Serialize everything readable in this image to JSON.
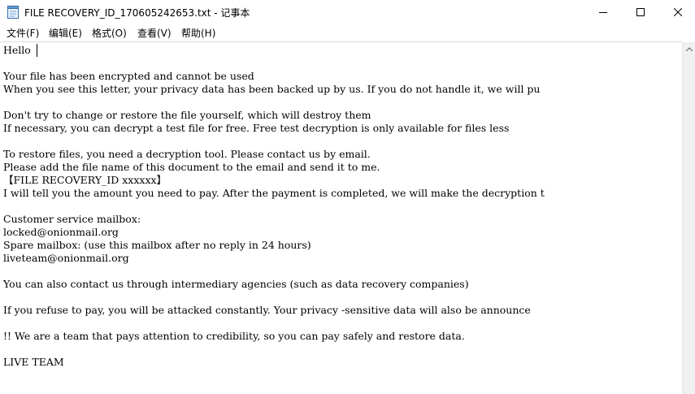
{
  "window": {
    "title": "FILE RECOVERY_ID_170605242653.txt - 记事本",
    "app_icon": "notepad-icon",
    "controls": {
      "minimize_icon": "minimize-icon",
      "maximize_icon": "maximize-icon",
      "close_icon": "close-icon"
    }
  },
  "menu": {
    "items": [
      {
        "label": "文件(F)"
      },
      {
        "label": "编辑(E)"
      },
      {
        "label": "格式(O)"
      },
      {
        "label": "查看(V)"
      },
      {
        "label": "帮助(H)"
      }
    ]
  },
  "editor": {
    "lines": [
      "Hello",
      "",
      "Your file has been encrypted and cannot be used",
      "When you see this letter, your privacy data has been backed up by us. If you do not handle it, we will pu",
      "",
      "Don't try to change or restore the file yourself, which will destroy them",
      "If necessary, you can decrypt a test file for free. Free test decryption is only available for files less",
      "",
      "To restore files, you need a decryption tool. Please contact us by email.",
      "Please add the file name of this document to the email and send it to me.",
      "【FILE RECOVERY_ID xxxxxx】",
      "I will tell you the amount you need to pay. After the payment is completed, we will make the decryption t",
      "",
      "Customer service mailbox:",
      "locked@onionmail.org",
      "Spare mailbox: (use this mailbox after no reply in 24 hours)",
      "liveteam@onionmail.org",
      "",
      "You can also contact us through intermediary agencies (such as data recovery companies)",
      "",
      "If you refuse to pay, you will be attacked constantly. Your privacy -sensitive data will also be announce",
      "",
      "!! We are a team that pays attention to credibility, so you can pay safely and restore data.",
      "",
      "LIVE TEAM"
    ]
  },
  "scrollbar": {
    "up_icon": "scroll-up-arrow-icon"
  }
}
